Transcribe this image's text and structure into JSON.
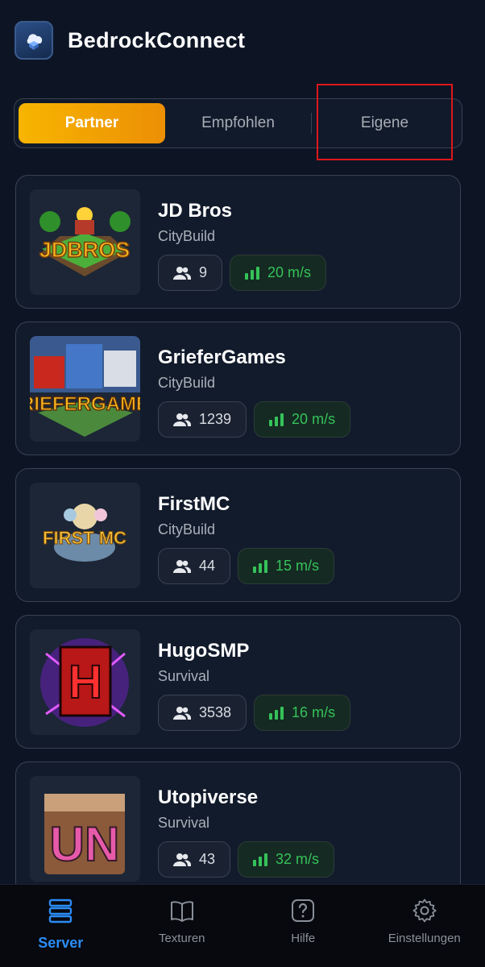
{
  "app": {
    "title": "BedrockConnect",
    "logo_icon": "cloud-cube-logo"
  },
  "tabs": [
    {
      "label": "Partner",
      "active": true
    },
    {
      "label": "Empfohlen",
      "active": false
    },
    {
      "label": "Eigene",
      "active": false
    }
  ],
  "servers": [
    {
      "name": "JD Bros",
      "category": "CityBuild",
      "players": "9",
      "ping": "20 m/s",
      "logo_text": "JDBROS"
    },
    {
      "name": "GrieferGames",
      "category": "CityBuild",
      "players": "1239",
      "ping": "20 m/s",
      "logo_text": "RIEFERGAME"
    },
    {
      "name": "FirstMC",
      "category": "CityBuild",
      "players": "44",
      "ping": "15 m/s",
      "logo_text": "FIRST MC"
    },
    {
      "name": "HugoSMP",
      "category": "Survival",
      "players": "3538",
      "ping": "16 m/s",
      "logo_text": "H"
    },
    {
      "name": "Utopiverse",
      "category": "Survival",
      "players": "43",
      "ping": "32 m/s",
      "logo_text": "UN"
    }
  ],
  "nav": [
    {
      "label": "Server",
      "icon": "server-icon",
      "active": true
    },
    {
      "label": "Texturen",
      "icon": "book-icon",
      "active": false
    },
    {
      "label": "Hilfe",
      "icon": "help-icon",
      "active": false
    },
    {
      "label": "Einstellungen",
      "icon": "gear-icon",
      "active": false
    }
  ],
  "colors": {
    "accent": "#f7b500",
    "ping_green": "#35c25a",
    "nav_active": "#2b8cf5",
    "highlight": "#e0161b"
  }
}
